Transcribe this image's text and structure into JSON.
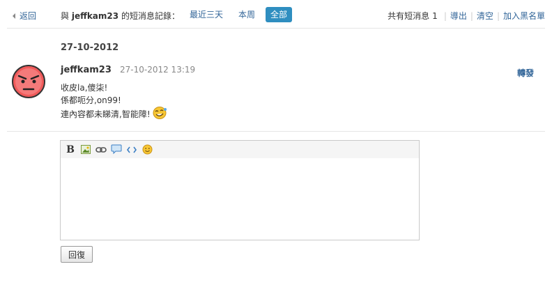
{
  "header": {
    "back_label": "返回",
    "title_prefix": "與",
    "username": "jeffkam23",
    "title_suffix": "的短消息記錄：",
    "filters": [
      {
        "label": "最近三天",
        "active": false
      },
      {
        "label": "本周",
        "active": false
      },
      {
        "label": "全部",
        "active": true
      }
    ],
    "count_label": "共有短消息",
    "count_value": "1",
    "export_label": "導出",
    "clear_label": "清空",
    "blacklist_label": "加入黑名單"
  },
  "conversation": {
    "date_heading": "27-10-2012",
    "message": {
      "user": "jeffkam23",
      "time": "27-10-2012 13:19",
      "forward_label": "轉發",
      "lines": [
        "收皮la,傻柒!",
        "係都呃分,on99!",
        "連內容都未睇清,智能障!"
      ]
    }
  },
  "editor": {
    "toolbar_icons": [
      "bold-icon",
      "image-icon",
      "link-icon",
      "quote-icon",
      "code-icon",
      "smiley-icon"
    ],
    "text": ""
  },
  "reply_button_label": "回復",
  "colors": {
    "link": "#336699",
    "active_filter_bg": "#2f8ec0",
    "avatar_face": "#f05a5a"
  }
}
